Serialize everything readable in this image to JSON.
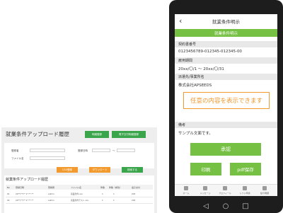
{
  "desktop": {
    "title": "就業条件アップロード履歴",
    "header_buttons": [
      "明細登録",
      "電子交付明細登録"
    ],
    "form": {
      "label_1": "登録者",
      "label_2": "登録日時",
      "label_3": "ファイル名",
      "date_sep": "〜"
    },
    "action_buttons": [
      {
        "label": "CSV登録",
        "color": "#f39a2e"
      },
      {
        "label": "ダウンロード",
        "color": "#f39a2e"
      },
      {
        "label": "検索する",
        "color": "#3aa54a"
      }
    ],
    "section_title": "就業条件アップロード履歴",
    "columns": [
      "No",
      "登録日時",
      "登録者",
      "ファイル名",
      "件数",
      "件数（成功）",
      "電子交付"
    ],
    "rows": [
      [
        "01",
        "20**/**/** 1*:**:**",
        "admin",
        "就業条件.csv",
        "1",
        "1",
        "203"
      ],
      [
        "02",
        "20**/**/** 1*:**:**",
        "admin",
        "就業条件テスト.csv",
        "1",
        "1",
        "203"
      ]
    ]
  },
  "mobile": {
    "header_title": "就業条件明示",
    "banner": "就業条件明示",
    "fields": [
      {
        "label": "契約書番号",
        "value": "0123456789-012345-012345-00"
      },
      {
        "label": "雇用期間",
        "value": "20xx/〇/1 〜 20xx/〇/31"
      },
      {
        "label": "派遣先/事業所名",
        "value": "株式会社APSEEDS"
      }
    ],
    "free_text": "任意の内容を表示できます",
    "remarks_label": "備考",
    "remarks_value": "サンプル文面です。",
    "approve_label": "承認",
    "print_label": "印刷",
    "pdf_label": "pdf保存",
    "tabs": [
      "ホーム",
      "メッセージ",
      "プロフィール",
      "シフト申請",
      "給与明細"
    ],
    "accent": "#76c043",
    "free_text_color": "#f0962a"
  }
}
